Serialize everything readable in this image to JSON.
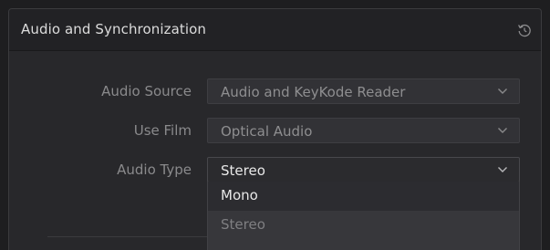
{
  "panel": {
    "title": "Audio and Synchronization",
    "reset_icon": "reset-icon"
  },
  "fields": [
    {
      "label": "Audio Source",
      "value": "Audio and KeyKode Reader"
    },
    {
      "label": "Use Film",
      "value": "Optical Audio"
    },
    {
      "label": "Audio Type",
      "value": "Stereo"
    }
  ],
  "audio_type_menu": {
    "options": [
      "Mono",
      "Stereo"
    ],
    "highlighted": "Mono",
    "selected": "Stereo"
  }
}
